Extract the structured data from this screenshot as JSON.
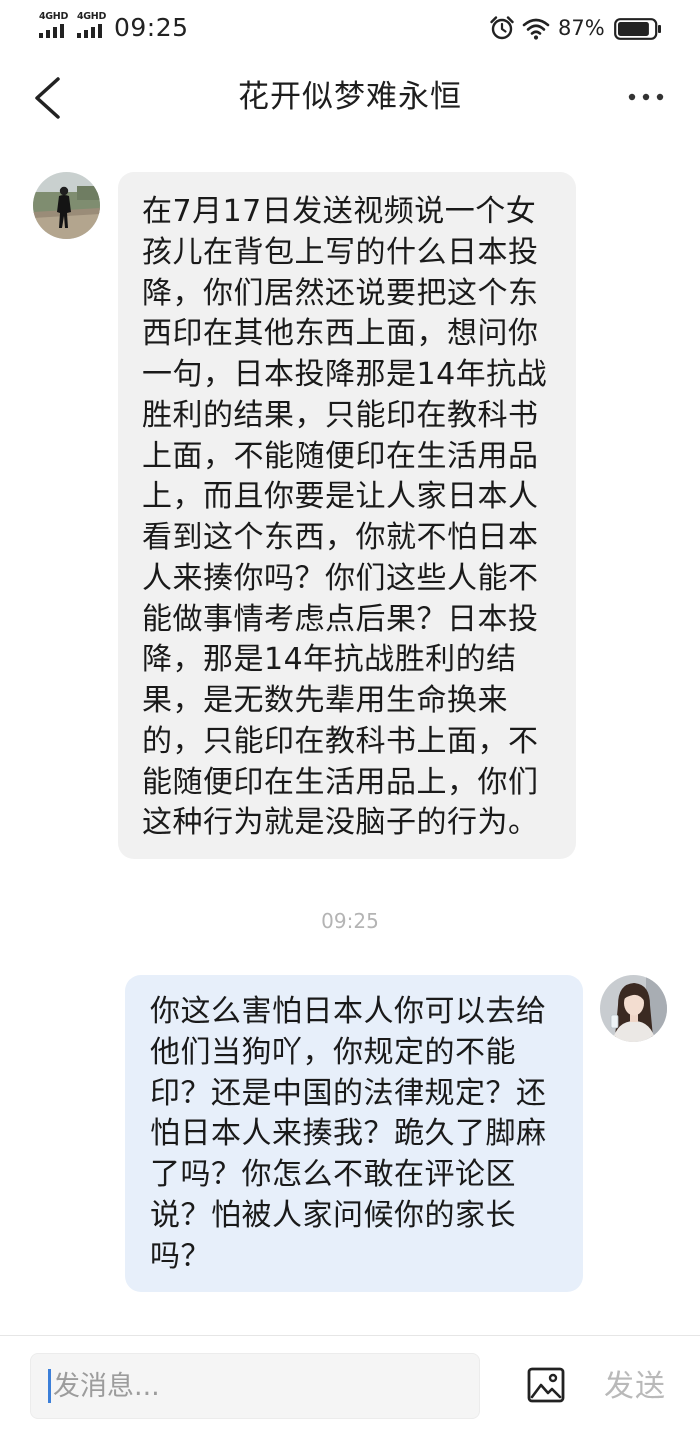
{
  "status_bar": {
    "signal_1": "4GHD",
    "signal_2": "4GHD",
    "time": "09:25",
    "battery_percent": "87%",
    "battery_level": 0.87,
    "icons": [
      "signal-icon",
      "alarm-icon",
      "wifi-icon",
      "battery-icon"
    ]
  },
  "header": {
    "title": "花开似梦难永恒",
    "back_icon": "chevron-left-icon",
    "more_icon": "more-icon"
  },
  "chat": {
    "messages": [
      {
        "from": "contact",
        "lines": [
          "在7月17日发送视频说一个女",
          "孩儿在背包上写的什么日本投",
          "降，你们居然还说要把这个东",
          "西印在其他东西上面，想问你",
          "一句，日本投降那是14年抗战",
          "胜利的结果，只能印在教科书",
          "上面，不能随便印在生活用品",
          "上，而且你要是让人家日本人",
          "看到这个东西，你就不怕日本",
          "人来揍你吗？你们这些人能不",
          "能做事情考虑点后果？日本投",
          "降，那是14年抗战胜利的结",
          "果，是无数先辈用生命换来",
          "的，只能印在教科书上面，不",
          "能随便印在生活用品上，你们",
          "这种行为就是没脑子的行为。"
        ]
      },
      {
        "from": "me",
        "lines": [
          "你这么害怕日本人你可以去给",
          "他们当狗吖，你规定的不能",
          "印？还是中国的法律规定？还",
          "怕日本人来揍我？跪久了脚麻",
          "了吗？你怎么不敢在评论区",
          "说？怕被人家问候你的家长",
          "吗？"
        ]
      }
    ],
    "timestamp": "09:25"
  },
  "composer": {
    "placeholder": "发消息...",
    "send_label": "发送",
    "image_icon": "image-icon"
  },
  "colors": {
    "received_bubble": "#f1f1f1",
    "sent_bubble": "#e7effa",
    "timestamp": "#b4b4b4",
    "caret": "#3c7fd9",
    "send_label": "#b9b9b9"
  }
}
